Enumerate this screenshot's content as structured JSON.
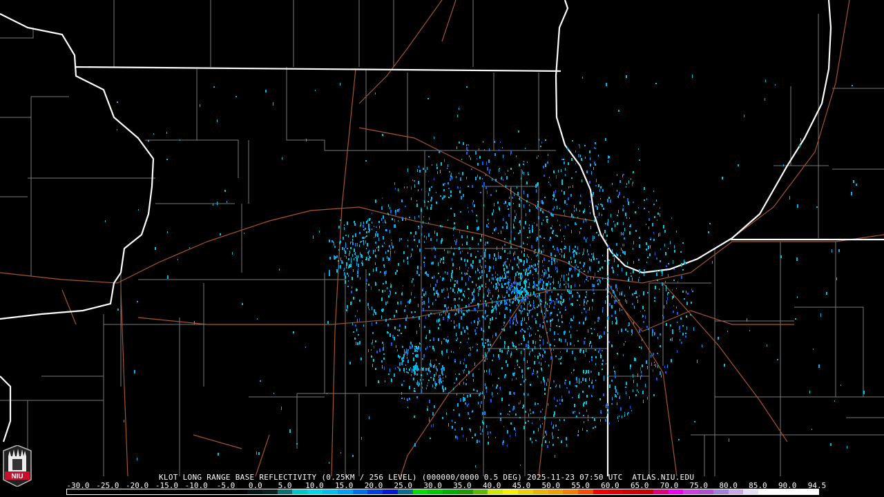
{
  "title": "KLOT LONG RANGE BASE REFLECTIVITY (0.25KM / 256 LEVEL) (000000/0000 0.5 DEG) 2025-11-23 07:50 UTC  ATLAS.NIU.EDU",
  "colorbar": {
    "labels": [
      "-30.0",
      "-25.0",
      "-20.0",
      "-15.0",
      "-10.0",
      "-5.0",
      "0.0",
      "5.0",
      "10.0",
      "15.0",
      "20.0",
      "25.0",
      "30.0",
      "35.0",
      "40.0",
      "45.0",
      "50.0",
      "55.0",
      "60.0",
      "65.0",
      "70.0",
      "75.0",
      "80.0",
      "85.0",
      "90.0",
      "94.5"
    ],
    "colors": [
      "#000000",
      "#000000",
      "#000000",
      "#000000",
      "#000000",
      "#000000",
      "#000000",
      "#000000",
      "#000000",
      "#000000",
      "#000000",
      "#000000",
      "#041414",
      "#0a1e1e",
      "#0c7070",
      "#00c8c8",
      "#00d8e8",
      "#00c0f0",
      "#00a0f8",
      "#0070f0",
      "#0040e0",
      "#0018d0",
      "#08708a",
      "#00e000",
      "#00c800",
      "#00b000",
      "#209800",
      "#60b800",
      "#d0e800",
      "#f8f000",
      "#f0d000",
      "#e8b800",
      "#f0a000",
      "#f88000",
      "#f85000",
      "#f00000",
      "#e00000",
      "#d00000",
      "#c80000",
      "#e00080",
      "#f000f0",
      "#d040e0",
      "#b050d0",
      "#a080d8",
      "#c8a8e8",
      "#e8e0f8",
      "#ffffff",
      "#ffffff",
      "#ffffff",
      "#ffffff"
    ]
  },
  "logo": {
    "text": "NIU"
  },
  "colors": {
    "state_border": "#ffffff",
    "county": "#808080",
    "highway": "#b05a2a",
    "radar_low": "#00b8f0"
  }
}
